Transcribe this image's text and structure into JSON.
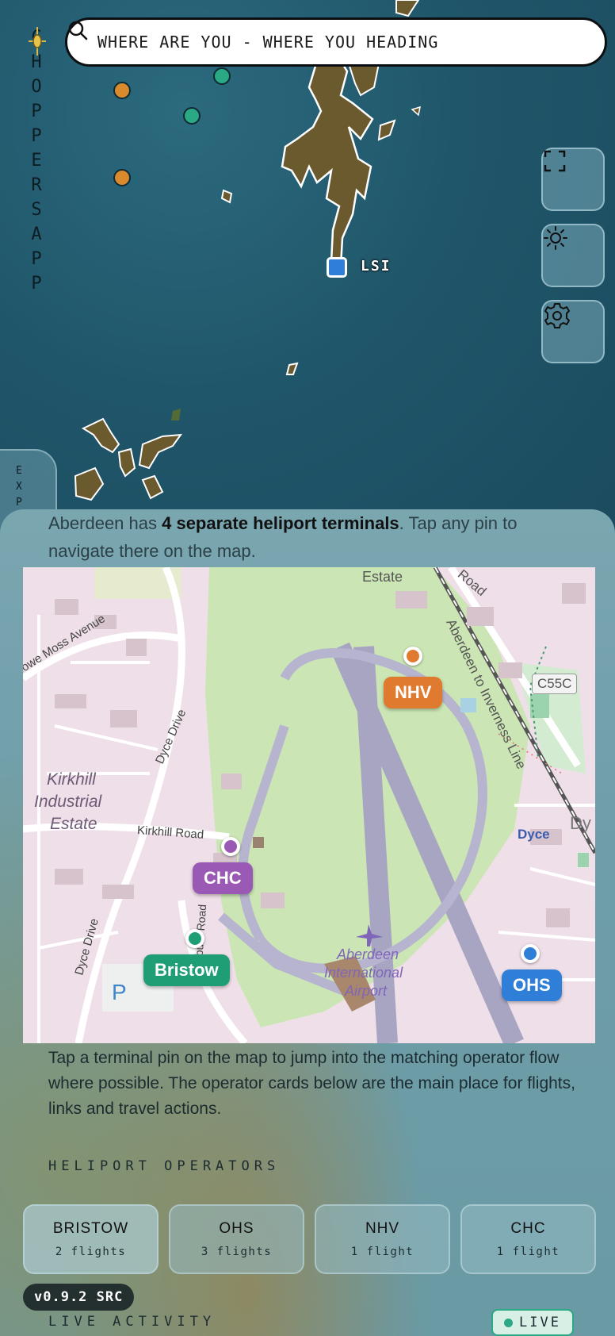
{
  "app": {
    "brand_text": "CHOPPERS APP",
    "brand_logo_icon": "helicopter-logo-icon"
  },
  "search": {
    "placeholder": "WHERE ARE YOU - WHERE YOU HEADING",
    "icon": "search-icon"
  },
  "map_controls": [
    {
      "name": "fullscreen-button",
      "icon": "fullscreen-icon"
    },
    {
      "name": "brightness-button",
      "icon": "sun-icon"
    },
    {
      "name": "settings-button",
      "icon": "gear-icon"
    }
  ],
  "sea_map": {
    "marker_label": "LSI",
    "marker_color": "#2f7fd9",
    "dot_colors": {
      "orange": "#d98a2c",
      "green": "#2ba884"
    }
  },
  "exp_tab": {
    "label": "EXP"
  },
  "sheet": {
    "intro_prefix": "Aberdeen has ",
    "intro_bold": "4 separate heliport terminals",
    "intro_suffix": ". Tap any pin to navigate there on the map.",
    "terminal_pins": [
      {
        "label": "NHV",
        "color": "#e07a2f"
      },
      {
        "label": "CHC",
        "color": "#9b59b6"
      },
      {
        "label": "Bristow",
        "color": "#1f9e76"
      },
      {
        "label": "OHS",
        "color": "#2f7fd9"
      }
    ],
    "map_labels": {
      "estate_top": "Estate",
      "road_top": "Road",
      "howe_moss": "Howe Moss Avenue",
      "aberdeen_inverness": "Aberdeen to Inverness Line",
      "c55c": "C55C",
      "dyce_drive": "Dyce Drive",
      "dyce_drive_2": "Dyce Drive",
      "kirkhill_1": "Kirkhill",
      "kirkhill_2": "Industrial",
      "kirkhill_3": "Estate",
      "kirkhill_road": "Kirkhill Road",
      "dyce": "Dyce",
      "dy": "Dy",
      "airport_1": "Aberdeen",
      "airport_2": "International",
      "airport_3": "Airport",
      "farburn": "Farburn Road",
      "parking": "P"
    },
    "tap_text": "Tap a terminal pin on the map to jump into the matching operator flow where possible. The operator cards below are the main place for flights, links and travel actions.",
    "operators_heading": "HELIPORT OPERATORS",
    "operators": [
      {
        "name": "BRISTOW",
        "flights": "2 flights"
      },
      {
        "name": "OHS",
        "flights": "3 flights"
      },
      {
        "name": "NHV",
        "flights": "1 flight"
      },
      {
        "name": "CHC",
        "flights": "1 flight"
      }
    ],
    "version": "v0.9.2 SRC",
    "live_activity_heading": "LIVE ACTIVITY",
    "live_badge": "LIVE"
  }
}
